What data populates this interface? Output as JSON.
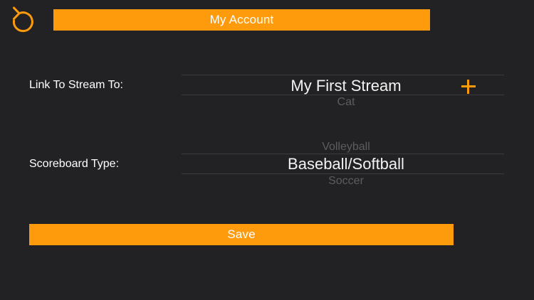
{
  "header": {
    "title": "My Account",
    "back_icon": "refresh-back-icon"
  },
  "form": {
    "stream_label": "Link To Stream To:",
    "stream_picker": {
      "selected": "My First Stream",
      "next": "Cat"
    },
    "add_icon": "plus-icon",
    "scoreboard_label": "Scoreboard Type:",
    "scoreboard_picker": {
      "previous": "Volleyball",
      "selected": "Baseball/Softball",
      "next": "Soccer"
    }
  },
  "actions": {
    "save_label": "Save"
  },
  "colors": {
    "background": "#222224",
    "accent": "#fe9b0d",
    "text": "#ffffff",
    "muted_text": "#5d5d61",
    "divider": "#3b3b3e"
  }
}
